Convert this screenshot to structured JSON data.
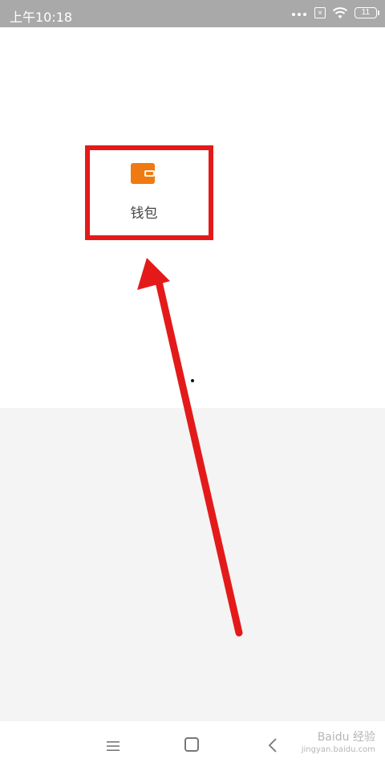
{
  "status_bar": {
    "time": "上午10:18",
    "battery_level": "11"
  },
  "wallet": {
    "label": "钱包",
    "icon": "wallet-icon",
    "color": "#f07a12"
  },
  "annotation": {
    "color": "#e41a1a"
  },
  "nav_bar": {
    "menu_icon": "menu-icon",
    "home_icon": "home-icon",
    "back_icon": "back-icon"
  },
  "watermark": {
    "brand": "Baidu 经验",
    "sub": "jingyan.baidu.com"
  }
}
